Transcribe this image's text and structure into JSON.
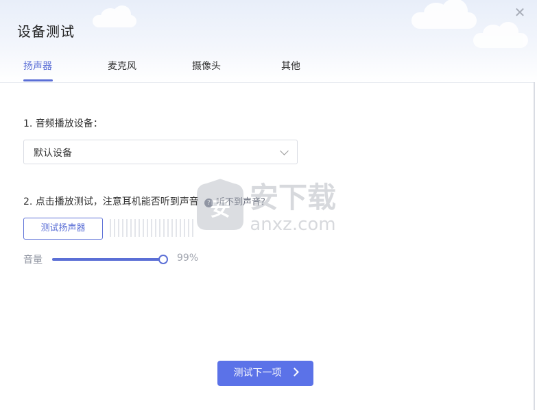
{
  "window": {
    "title": "设备测试",
    "close_icon": "close-icon"
  },
  "tabs": [
    {
      "label": "扬声器",
      "active": true
    },
    {
      "label": "麦克风",
      "active": false
    },
    {
      "label": "摄像头",
      "active": false
    },
    {
      "label": "其他",
      "active": false
    }
  ],
  "speaker": {
    "device_label": "1. 音频播放设备：",
    "device_value": "默认设备",
    "test_instruction": "2. 点击播放测试，注意耳机能否听到声音",
    "help_link": "听不到声音？",
    "test_button": "测试扬声器",
    "volume_label": "音量",
    "volume_value": "99%",
    "volume_fraction": 0.99
  },
  "footer": {
    "next_button": "测试下一项"
  },
  "watermark": {
    "text": "安下载",
    "subtext": "anxz.com"
  },
  "colors": {
    "accent": "#5b6fd6",
    "button_fill": "#5b72e8"
  }
}
